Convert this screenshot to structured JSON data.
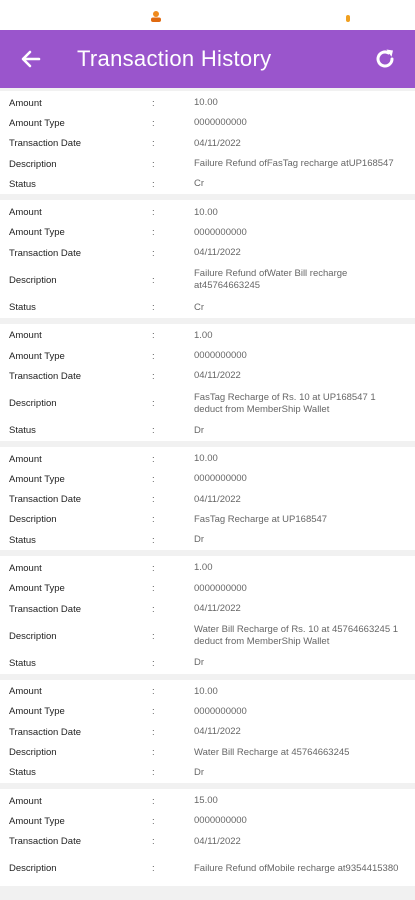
{
  "app": {
    "title": "Transaction History"
  },
  "colors": {
    "appbar": "#9a55cc",
    "status_dot": "#f0a020"
  },
  "icons": {
    "back": "back-arrow-icon",
    "refresh": "refresh-icon"
  },
  "field_labels": {
    "amount": "Amount",
    "amount_type": "Amount Type",
    "transaction_date": "Transaction Date",
    "description": "Description",
    "status": "Status",
    "separator": ":"
  },
  "transactions": [
    {
      "amount": "10.00",
      "amount_type": "0000000000",
      "transaction_date": "04/11/2022",
      "description": "Failure Refund ofFasTag recharge atUP168547",
      "status": "Cr"
    },
    {
      "amount": "10.00",
      "amount_type": "0000000000",
      "transaction_date": "04/11/2022",
      "description": "Failure Refund ofWater Bill recharge at45764663245",
      "status": "Cr"
    },
    {
      "amount": "1.00",
      "amount_type": "0000000000",
      "transaction_date": "04/11/2022",
      "description": "FasTag Recharge of Rs. 10 at UP168547 1 deduct from MemberShip Wallet",
      "status": "Dr"
    },
    {
      "amount": "10.00",
      "amount_type": "0000000000",
      "transaction_date": "04/11/2022",
      "description": "FasTag Recharge at UP168547",
      "status": "Dr"
    },
    {
      "amount": "1.00",
      "amount_type": "0000000000",
      "transaction_date": "04/11/2022",
      "description": "Water Bill Recharge of Rs. 10 at 45764663245 1 deduct from MemberShip Wallet",
      "status": "Dr"
    },
    {
      "amount": "10.00",
      "amount_type": "0000000000",
      "transaction_date": "04/11/2022",
      "description": "Water Bill Recharge at 45764663245",
      "status": "Dr"
    },
    {
      "amount": "15.00",
      "amount_type": "0000000000",
      "transaction_date": "04/11/2022",
      "description": "Failure Refund ofMobile recharge at9354415380",
      "status": ""
    }
  ]
}
